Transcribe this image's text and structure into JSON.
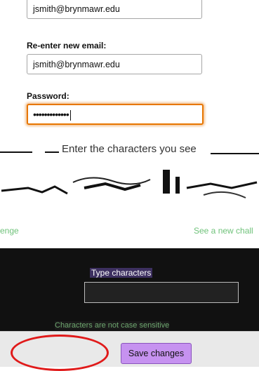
{
  "form": {
    "new_email_value": "jsmith@brynmawr.edu",
    "reenter_label": "Re-enter new email:",
    "reenter_value": "jsmith@brynmawr.edu",
    "password_label": "Password:",
    "password_value": "•••••••••••••"
  },
  "captcha": {
    "heading": "Enter the characters you see",
    "challenge_link_left": "enge",
    "challenge_link_right": "See a new chall",
    "type_label": "Type characters",
    "hint": "Characters are not case sensitive"
  },
  "footer": {
    "save_label": "Save changes"
  },
  "colors": {
    "focus_border": "#e77600",
    "save_button": "#c692f0",
    "link": "#6fc27a",
    "annotation": "#e01a1a"
  }
}
